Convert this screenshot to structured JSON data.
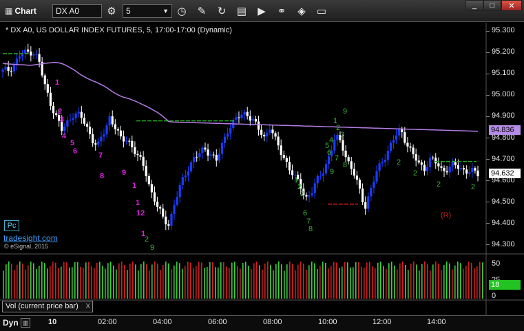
{
  "toolbar": {
    "chart_label": "Chart",
    "symbol": "DX A0",
    "interval": "5",
    "icons": [
      "chart-icon",
      "settings-icon",
      "dropdown-icon",
      "clock-icon",
      "pencil-icon",
      "refresh-icon",
      "page-icon",
      "play-icon",
      "link-icon",
      "tag-icon",
      "comment-icon"
    ]
  },
  "header": {
    "title": "* DX A0, US DOLLAR INDEX FUTURES, 5, 17:00-17:00 (Dynamic)"
  },
  "price_axis": {
    "labels": [
      "95.300",
      "95.200",
      "95.100",
      "95.000",
      "94.900",
      "94.800",
      "94.700",
      "94.600",
      "94.500",
      "94.400",
      "94.300"
    ]
  },
  "tags": {
    "ma": "94.836",
    "last": "94.632",
    "vol": "18"
  },
  "volume_axis": {
    "labels": [
      "50",
      "25",
      "0"
    ]
  },
  "time_axis": {
    "labels": [
      "10",
      "02:00",
      "04:00",
      "06:00",
      "08:00",
      "10:00",
      "12:00",
      "14:00"
    ]
  },
  "panel": {
    "pc_label": "Pc",
    "brand": "tradesight.com",
    "copyright": "© eSignal, 2015",
    "review_marker": "(R)"
  },
  "vol_study": {
    "label": "Vol (current price bar)",
    "close_label": "X"
  },
  "bottom": {
    "mode": "Dyn"
  },
  "counts_magenta": [
    "1",
    "2",
    "3",
    "4",
    "5",
    "6",
    "7",
    "8",
    "9",
    "1",
    "1",
    "12",
    "1"
  ],
  "counts_green": [
    "9",
    "1",
    "2",
    "3",
    "4",
    "5",
    "6",
    "7",
    "8",
    "9",
    "1",
    "2",
    "2",
    "6",
    "7",
    "8",
    "9",
    "2",
    "2",
    "2",
    "2",
    "2"
  ],
  "colors": {
    "up_bar": "#1a3cff",
    "down_bar": "#ffffff",
    "ma": "#b47ce6",
    "count_magenta": "#e020e0",
    "count_green": "#3bb33b",
    "vol_up": "#3ccf3c",
    "vol_down": "#d02020",
    "level": "#22aa22",
    "ma_tag": "#b48be6",
    "last_tag": "#ffffff",
    "vol_tag": "#22c322"
  },
  "chart_data": {
    "type": "candlestick",
    "ylim": [
      94.26,
      95.34
    ],
    "x_ticks": [
      "10",
      "02:00",
      "04:00",
      "06:00",
      "08:00",
      "10:00",
      "12:00",
      "14:00"
    ],
    "close_path": [
      95.11,
      95.12,
      95.15,
      95.19,
      95.2,
      95.21,
      95.17,
      95.05,
      94.97,
      94.9,
      94.83,
      94.88,
      94.92,
      94.9,
      94.86,
      94.8,
      94.76,
      94.82,
      94.9,
      94.85,
      94.78,
      94.8,
      94.75,
      94.7,
      94.65,
      94.55,
      94.48,
      94.42,
      94.4,
      94.5,
      94.58,
      94.65,
      94.7,
      94.72,
      94.75,
      94.73,
      94.69,
      94.77,
      94.85,
      94.88,
      94.9,
      94.92,
      94.89,
      94.84,
      94.8,
      94.86,
      94.78,
      94.72,
      94.68,
      94.62,
      94.58,
      94.52,
      94.55,
      94.6,
      94.65,
      94.72,
      94.8,
      94.78,
      94.7,
      94.64,
      94.56,
      94.48,
      94.56,
      94.64,
      94.7,
      94.75,
      94.8,
      94.84,
      94.78,
      94.72,
      94.68,
      94.66,
      94.7,
      94.68,
      94.65,
      94.66,
      94.67,
      94.66,
      94.65,
      94.64,
      94.63
    ],
    "ma_value": 94.836,
    "last_value": 94.632,
    "levels": [
      95.195,
      94.88,
      94.69,
      94.49
    ]
  }
}
